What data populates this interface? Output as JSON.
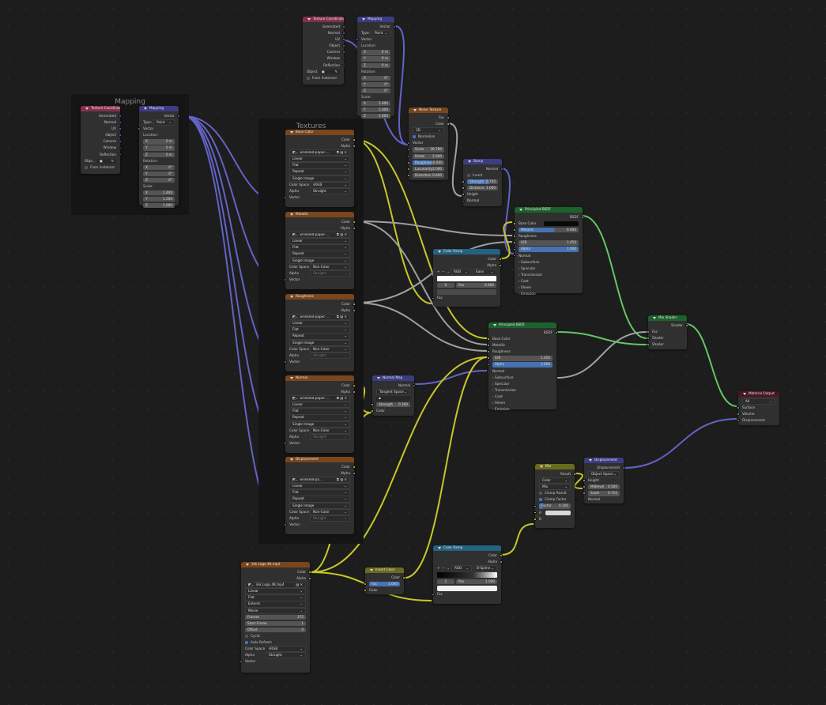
{
  "colors": {
    "float": "#a1a1a1",
    "color": "#c7c729",
    "vector": "#6363c7",
    "shader": "#63c763",
    "h_input": "#83314a",
    "h_vector": "#3c3c83",
    "h_texture": "#79461d",
    "h_converter": "#246283",
    "h_shader": "#1b632b",
    "h_output": "#4c1721",
    "h_color": "#6a6a1c"
  },
  "frames": {
    "mapping": "Mapping",
    "textures": "Textures"
  },
  "tc1": {
    "title": "Texture Coordinate",
    "outs": [
      "Generated",
      "Normal",
      "UV",
      "Object",
      "Camera",
      "Window",
      "Reflection"
    ],
    "object_label": "Object",
    "from_instancer": "From Instancer"
  },
  "map1": {
    "title": "Mapping",
    "vector_out": "Vector",
    "type_label": "Type:",
    "type": "Point",
    "vector_in": "Vector",
    "location": "Location:",
    "rotation": "Rotation:",
    "scale": "Scale:",
    "loc": [
      "0 m",
      "0 m",
      "0 m"
    ],
    "rot": [
      "0°",
      "0°",
      "0°"
    ],
    "scl": [
      "1.000",
      "1.000",
      "1.000"
    ],
    "x": "X",
    "y": "Y",
    "z": "Z"
  },
  "tc2": {
    "title": "Texture Coordinate",
    "outs": [
      "Generated",
      "Normal",
      "UV",
      "Object",
      "Camera",
      "Window",
      "Reflection"
    ],
    "object_label": "Obje...",
    "from_instancer": "From Instancer"
  },
  "map2": {
    "title": "Mapping",
    "vector_out": "Vector",
    "type_label": "Type:",
    "type": "Point",
    "vector_in": "Vector",
    "location": "Location:",
    "rotation": "Rotation:",
    "scale": "Scale:",
    "loc": [
      "0 m",
      "0 m",
      "0 m"
    ],
    "rot": [
      "0°",
      "0°",
      "0°"
    ],
    "scl": [
      "1.400",
      "1.200",
      "1.000"
    ],
    "x": "X",
    "y": "Y",
    "z": "Z"
  },
  "img": {
    "color": "Color",
    "alpha": "Alpha",
    "file": "wrinkled-paper-...",
    "interp": "Linear",
    "proj": "Flat",
    "ext": "Repeat",
    "src": "Single Image",
    "cs_label": "Color Space",
    "alpha_label": "Alpha",
    "alpha_val": "Straight",
    "vector": "Vector"
  },
  "tex_nodes": [
    {
      "title": "Base Color",
      "cs": "sRGB"
    },
    {
      "title": "Metallic",
      "cs": "Non-Color"
    },
    {
      "title": "Roughness",
      "cs": "Non-Color"
    },
    {
      "title": "Normal",
      "cs": "Non-Color"
    },
    {
      "title": "Displacement",
      "cs": "Non-Color",
      "file": "wrinkled-pa...",
      "users": "2"
    }
  ],
  "noise": {
    "title": "Noise Texture",
    "fac": "Fac",
    "color": "Color",
    "dim": "3D",
    "normalize": "Normalize",
    "vector": "Vector",
    "fields": [
      [
        "Scale",
        "30.780"
      ],
      [
        "Detail",
        "2.000"
      ],
      [
        "Roughness",
        "0.600"
      ],
      [
        "Lacunarity",
        "2.000"
      ],
      [
        "Distortion",
        "0.600"
      ]
    ]
  },
  "bump": {
    "title": "Bump",
    "normal_out": "Normal",
    "invert": "Invert",
    "strength": [
      "Strength",
      "0.700"
    ],
    "distance": [
      "Distance",
      "1.000"
    ],
    "height": "Height",
    "normal": "Normal"
  },
  "ramp1": {
    "title": "Color Ramp",
    "color": "Color",
    "alpha": "Alpha",
    "mode": "RGB",
    "interp": "Ease",
    "idx": "0",
    "pos_label": "Pos",
    "pos": "0.600",
    "fac": "Fac"
  },
  "bsdf1": {
    "title": "Principled BSDF",
    "bsdf": "BSDF",
    "base_color": "Base Color",
    "metallic": [
      "Metallic",
      "0.600"
    ],
    "roughness": "Roughness",
    "ior": [
      "IOR",
      "1.450"
    ],
    "alpha": [
      "Alpha",
      "1.000"
    ],
    "normal": "Normal",
    "panels": [
      "Subsurface",
      "Specular",
      "Transmission",
      "Coat",
      "Sheen",
      "Emission"
    ]
  },
  "bsdf2": {
    "title": "Principled BSDF",
    "bsdf": "BSDF",
    "base_color": "Base Color",
    "metallic": "Metallic",
    "roughness": "Roughness",
    "ior": [
      "IOR",
      "1.450"
    ],
    "alpha": [
      "Alpha",
      "1.000"
    ],
    "normal": "Normal",
    "panels": [
      "Subsurface",
      "Specular",
      "Transmission",
      "Coat",
      "Sheen",
      "Emission"
    ]
  },
  "normal_map": {
    "title": "Normal Map",
    "normal_out": "Normal",
    "space": "Tangent Space",
    "uv": "",
    "strength": [
      "Strength",
      "0.300"
    ],
    "color": "Color"
  },
  "mix_shader": {
    "title": "Mix Shader",
    "shader_out": "Shader",
    "fac": "Fac",
    "shader1": "Shader",
    "shader2": "Shader"
  },
  "output": {
    "title": "Material Output",
    "target": "All",
    "surface": "Surface",
    "volume": "Volume",
    "displacement": "Displacement"
  },
  "mix": {
    "title": "Mix",
    "result": "Result",
    "type": "Color",
    "blend": "Mix",
    "clamp_result": "Clamp Result",
    "clamp_factor": "Clamp Factor",
    "factor": [
      "Factor",
      "0.106"
    ],
    "a": "A",
    "b": "B"
  },
  "disp": {
    "title": "Displacement",
    "disp_out": "Displacement",
    "space": "Object Space",
    "height": "Height",
    "midlevel": [
      "Midlevel",
      "0.500"
    ],
    "scale": [
      "Scale",
      "0.710"
    ],
    "normal": "Normal"
  },
  "movie": {
    "title": "3sk Logo 4K.mp4",
    "color": "Color",
    "alpha": "Alpha",
    "file": "3sk Logo 4K.mp4",
    "interp": "Linear",
    "proj": "Flat",
    "ext": "Extend",
    "src": "Movie",
    "frames": [
      "Frames",
      "372"
    ],
    "start": [
      "Start Frame",
      "1"
    ],
    "offset": [
      "Offset",
      "0"
    ],
    "cyclic": "Cyclic",
    "auto": "Auto Refresh",
    "cs_label": "Color Space",
    "cs": "sRGB",
    "alpha_label": "Alpha",
    "alpha_val": "Straight",
    "vector": "Vector"
  },
  "invert": {
    "title": "Invert Color",
    "color_out": "Color",
    "fac": [
      "Fac",
      "1.000"
    ],
    "color": "Color"
  },
  "ramp2": {
    "title": "Color Ramp",
    "color": "Color",
    "alpha": "Alpha",
    "mode": "RGB",
    "interp": "B-Spline",
    "idx": "1",
    "pos_label": "Pos",
    "pos": "1.000",
    "fac": "Fac"
  }
}
